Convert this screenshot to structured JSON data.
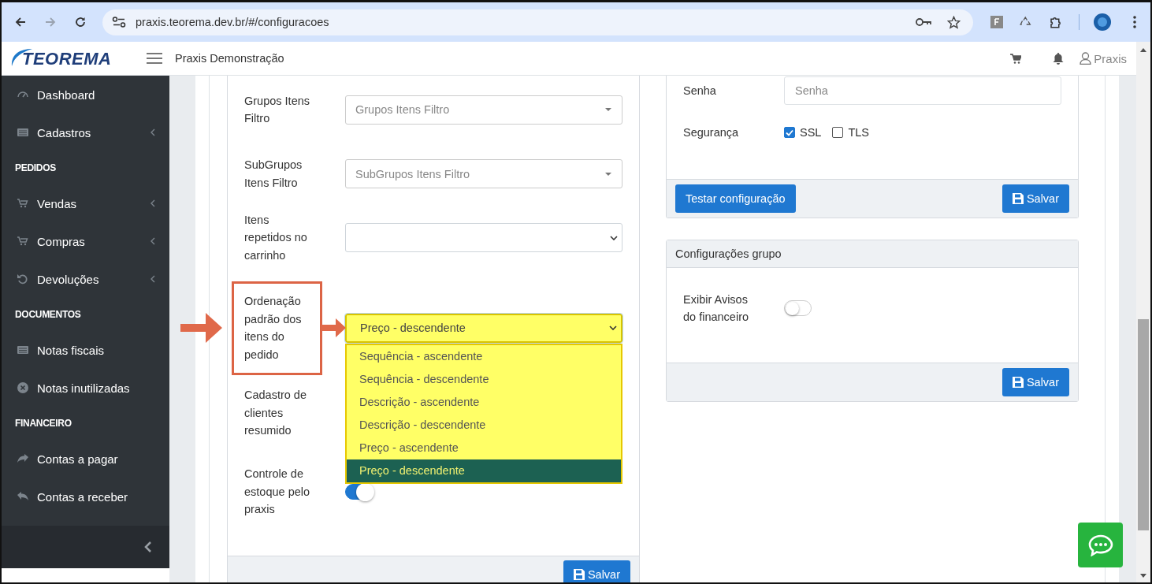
{
  "browser": {
    "url": "praxis.teorema.dev.br/#/configuracoes"
  },
  "header": {
    "logo": "TEOREMA",
    "title": "Praxis Demonstração",
    "user": "Praxis"
  },
  "sidebar": {
    "items": [
      {
        "kind": "item",
        "label": "Dashboard",
        "expandable": false
      },
      {
        "kind": "item",
        "label": "Cadastros",
        "expandable": true
      },
      {
        "kind": "header",
        "label": "PEDIDOS"
      },
      {
        "kind": "item",
        "label": "Vendas",
        "expandable": true
      },
      {
        "kind": "item",
        "label": "Compras",
        "expandable": true
      },
      {
        "kind": "item",
        "label": "Devoluções",
        "expandable": true
      },
      {
        "kind": "header",
        "label": "DOCUMENTOS"
      },
      {
        "kind": "item",
        "label": "Notas fiscais",
        "expandable": false
      },
      {
        "kind": "item",
        "label": "Notas inutilizadas",
        "expandable": false
      },
      {
        "kind": "header",
        "label": "FINANCEIRO"
      },
      {
        "kind": "item",
        "label": "Contas a pagar",
        "expandable": false
      },
      {
        "kind": "item",
        "label": "Contas a receber",
        "expandable": false
      }
    ]
  },
  "left_card": {
    "fields": [
      {
        "kind": "combo",
        "label": "Grupos Itens Filtro",
        "placeholder": "Grupos Itens Filtro"
      },
      {
        "kind": "combo",
        "label": "SubGrupos Itens Filtro",
        "placeholder": "SubGrupos Itens Filtro"
      },
      {
        "kind": "select",
        "label": "Itens repetidos no carrinho"
      },
      {
        "kind": "select",
        "label": "Ordenação padrão dos itens do pedido",
        "value": "Preço - descendente",
        "highlighted": true,
        "expanded": true,
        "options": [
          {
            "label": "Sequência - ascendente",
            "selected": false
          },
          {
            "label": "Sequência - descendente",
            "selected": false
          },
          {
            "label": "Descrição - ascendente",
            "selected": false
          },
          {
            "label": "Descrição - descendente",
            "selected": false
          },
          {
            "label": "Preço - ascendente",
            "selected": false
          },
          {
            "label": "Preço - descendente",
            "selected": true
          }
        ]
      },
      {
        "kind": "label",
        "label": "Cadastro de clientes resumido"
      },
      {
        "kind": "switch",
        "label": "Controle de estoque pelo praxis",
        "on": true
      }
    ],
    "buttons": [
      {
        "kind": "save",
        "label": "Salvar"
      }
    ]
  },
  "right_cards": [
    {
      "fields": [
        {
          "kind": "input",
          "label": "Senha",
          "placeholder": "Senha"
        },
        {
          "kind": "checkboxes",
          "label": "Segurança",
          "options": [
            {
              "label": "SSL",
              "checked": true
            },
            {
              "label": "TLS",
              "checked": false
            }
          ]
        }
      ],
      "buttons": [
        {
          "kind": "plain",
          "label": "Testar configuração"
        },
        {
          "kind": "save",
          "label": "Salvar"
        }
      ]
    },
    {
      "title": "Configurações grupo",
      "fields": [
        {
          "kind": "switch",
          "label": "Exibir Avisos do financeiro",
          "on": false
        }
      ],
      "buttons": [
        {
          "kind": "save",
          "label": "Salvar"
        }
      ]
    }
  ]
}
